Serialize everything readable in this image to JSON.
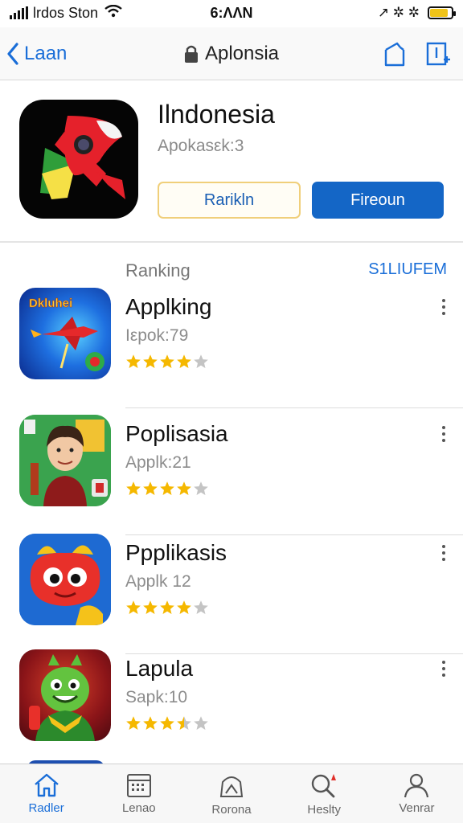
{
  "status_bar": {
    "carrier": "lrdos Ston",
    "time": "6:ΛΛN",
    "right_glyphs": "↗ ✲ ✲",
    "battery_level": 0.85
  },
  "nav": {
    "back_label": "Laan",
    "title": "Aplonsia"
  },
  "hero": {
    "title": "Ilndonesia",
    "subtitle": "Apokasεk:3",
    "button_secondary": "Rarikln",
    "button_primary": "Fireoun"
  },
  "section": {
    "label": "Ranking",
    "link": "S1LIUFEM"
  },
  "apps": [
    {
      "name": "Applking",
      "sub": "Iεpok:79",
      "rating": 4,
      "icon": "rocket-jet-icon",
      "badge": "Dkluhei"
    },
    {
      "name": "Poplisasia",
      "sub": "Applk:21",
      "rating": 4,
      "icon": "boy-portrait-icon"
    },
    {
      "name": "Ppplikasis",
      "sub": "Applk 12",
      "rating": 4,
      "icon": "red-monster-icon"
    },
    {
      "name": "Lapula",
      "sub": "Sapk:10",
      "rating": 3.5,
      "icon": "green-creature-icon"
    }
  ],
  "tabs": [
    {
      "label": "Radler",
      "icon": "home-icon",
      "active": true
    },
    {
      "label": "Lenao",
      "icon": "calendar-icon",
      "active": false
    },
    {
      "label": "Rorona",
      "icon": "mountain-icon",
      "active": false
    },
    {
      "label": "Heslty",
      "icon": "search-icon",
      "active": false
    },
    {
      "label": "Venrar",
      "icon": "person-icon",
      "active": false
    }
  ],
  "colors": {
    "accent": "#1a6ed8",
    "primary_button": "#1466c6",
    "star_filled": "#f5b800",
    "star_empty": "#c4c4c4"
  }
}
